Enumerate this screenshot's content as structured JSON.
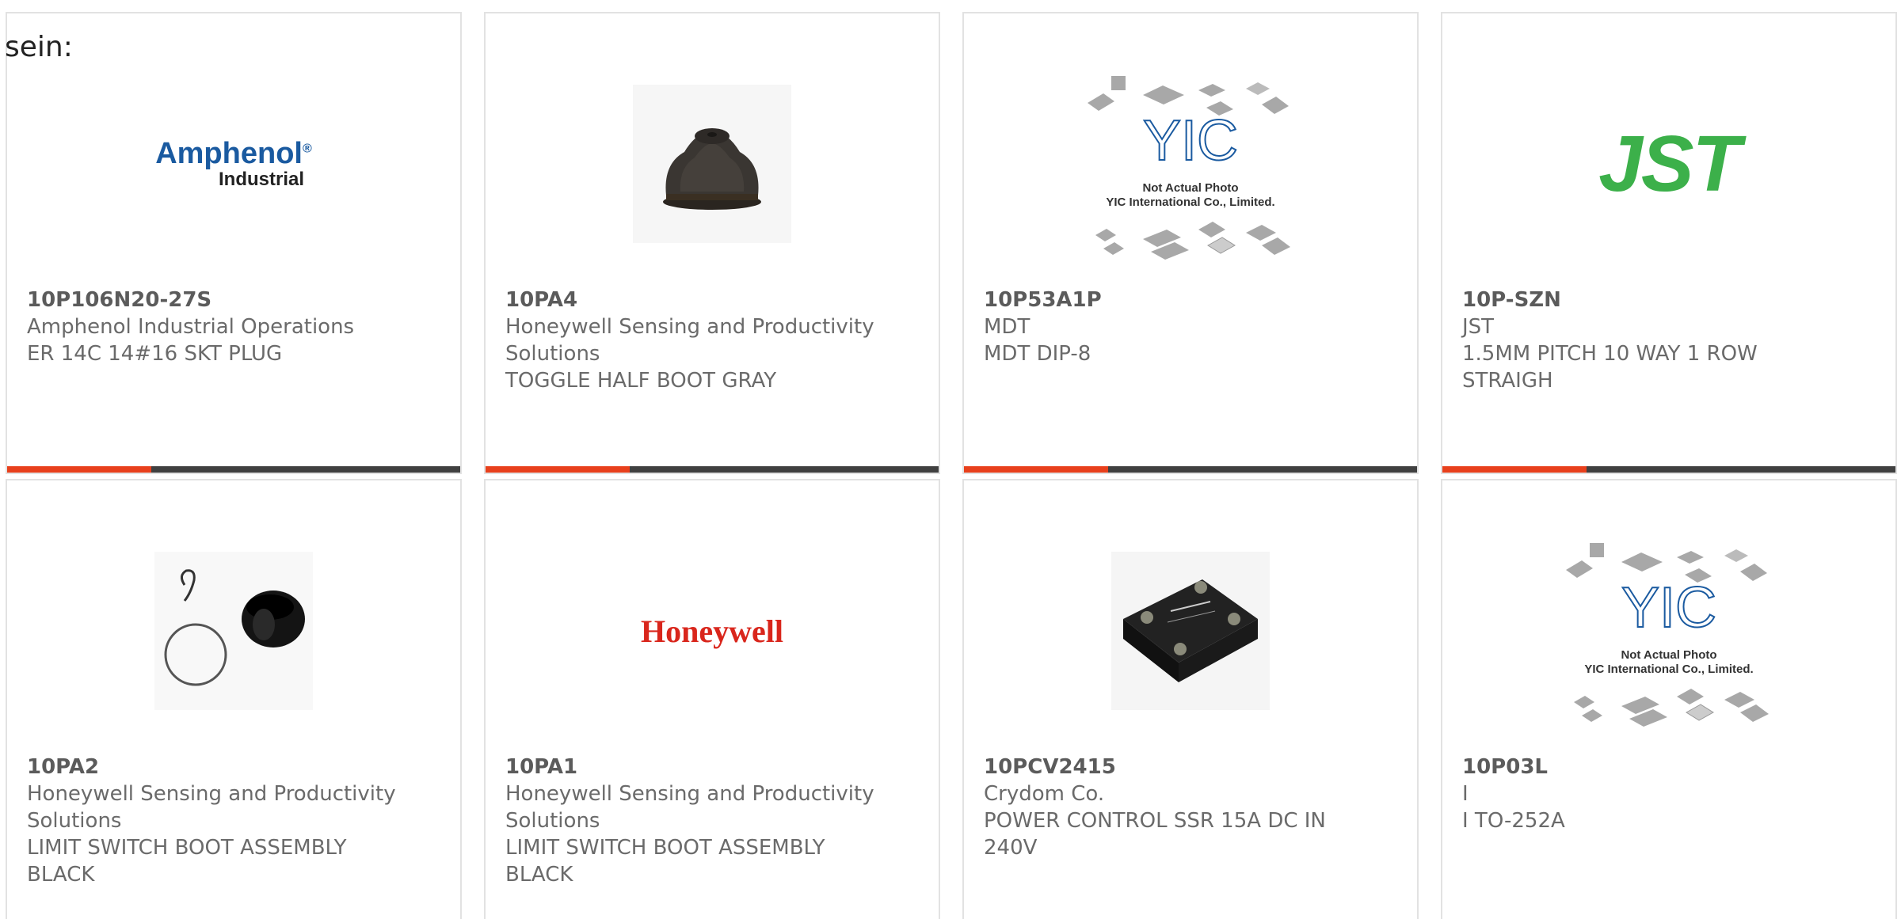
{
  "lead_text": "sein:",
  "products": [
    {
      "part_number": "10P106N20-27S",
      "manufacturer": "Amphenol Industrial Operations",
      "description": "ER 14C 14#16 SKT PLUG",
      "image": "amphenol-logo",
      "logo": {
        "line1": "Amphenol",
        "mark": "®",
        "line2": "Industrial"
      }
    },
    {
      "part_number": "10PA4",
      "manufacturer": "Honeywell Sensing and Productivity Solutions",
      "description": "TOGGLE HALF BOOT GRAY",
      "image": "toggle-boot-photo"
    },
    {
      "part_number": "10P53A1P",
      "manufacturer": "MDT",
      "description": "MDT DIP-8",
      "image": "yic-placeholder",
      "caption": {
        "line1": "Not Actual Photo",
        "line2": "YIC International Co., Limited."
      }
    },
    {
      "part_number": "10P-SZN",
      "manufacturer": "JST",
      "description": "1.5MM PITCH 10 WAY 1 ROW STRAIGH",
      "image": "jst-logo",
      "logo": {
        "text": "JST"
      }
    },
    {
      "part_number": "10PA2",
      "manufacturer": "Honeywell Sensing and Productivity Solutions",
      "description": "LIMIT SWITCH BOOT ASSEMBLY BLACK",
      "image": "boot-assembly-photo"
    },
    {
      "part_number": "10PA1",
      "manufacturer": "Honeywell Sensing and Productivity Solutions",
      "description": "LIMIT SWITCH BOOT ASSEMBLY BLACK",
      "image": "honeywell-logo",
      "logo": {
        "text": "Honeywell"
      }
    },
    {
      "part_number": "10PCV2415",
      "manufacturer": "Crydom Co.",
      "description": "POWER CONTROL SSR 15A DC IN 240V",
      "image": "ssr-relay-photo"
    },
    {
      "part_number": "10P03L",
      "manufacturer": "I",
      "description": "I TO-252A",
      "image": "yic-placeholder",
      "caption": {
        "line1": "Not Actual Photo",
        "line2": "YIC International Co., Limited."
      }
    }
  ],
  "colors": {
    "accent": "#e8401c",
    "bar": "#404040",
    "amphenol_blue": "#1a5aa0",
    "honeywell_red": "#d9261c",
    "jst_green": "#3cb04a"
  }
}
